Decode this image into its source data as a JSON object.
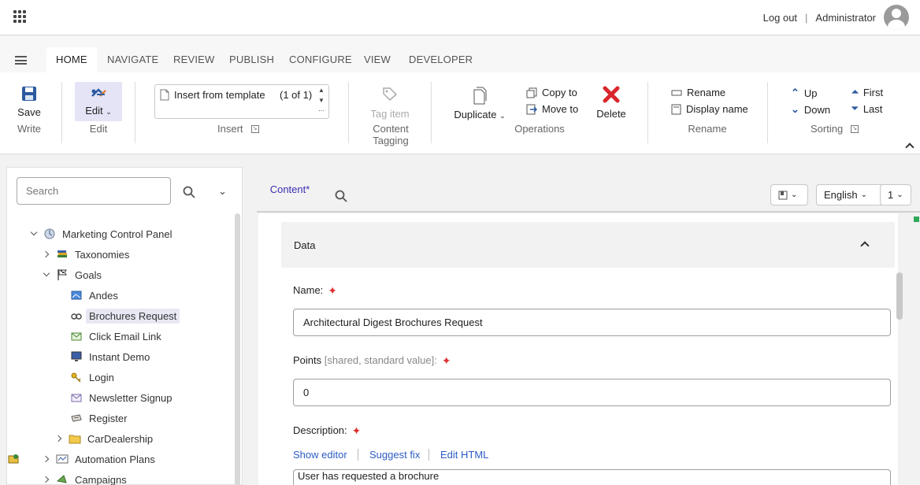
{
  "topbar": {
    "logout": "Log out",
    "separator": "|",
    "user": "Administrator"
  },
  "ribbon_tabs": [
    "HOME",
    "NAVIGATE",
    "REVIEW",
    "PUBLISH",
    "CONFIGURE",
    "VIEW",
    "DEVELOPER"
  ],
  "ribbon": {
    "write": {
      "save": "Save",
      "group": "Write"
    },
    "edit": {
      "edit": "Edit",
      "group": "Edit"
    },
    "insert": {
      "template": "Insert from template",
      "count": "(1 of 1)",
      "group": "Insert"
    },
    "tagging": {
      "tag_item": "Tag item",
      "group": "Content Tagging"
    },
    "operations": {
      "duplicate": "Duplicate",
      "copy_to": "Copy to",
      "move_to": "Move to",
      "delete": "Delete",
      "group": "Operations"
    },
    "rename": {
      "rename": "Rename",
      "display_name": "Display name",
      "group": "Rename"
    },
    "sorting": {
      "up": "Up",
      "down": "Down",
      "first": "First",
      "last": "Last",
      "group": "Sorting"
    }
  },
  "left": {
    "search_placeholder": "Search",
    "tree": [
      {
        "label": "Marketing Control Panel",
        "icon": "control-panel-icon"
      },
      {
        "label": "Taxonomies",
        "icon": "books-icon"
      },
      {
        "label": "Goals",
        "icon": "flag-icon"
      },
      {
        "label": "Andes",
        "icon": "brochure-icon"
      },
      {
        "label": "Brochures Request",
        "icon": "glasses-icon"
      },
      {
        "label": "Click Email Link",
        "icon": "email-link-icon"
      },
      {
        "label": "Instant Demo",
        "icon": "monitor-icon"
      },
      {
        "label": "Login",
        "icon": "key-icon"
      },
      {
        "label": "Newsletter Signup",
        "icon": "envelope-icon"
      },
      {
        "label": "Register",
        "icon": "register-icon"
      },
      {
        "label": "CarDealership",
        "icon": "folder-icon"
      },
      {
        "label": "Automation Plans",
        "icon": "automation-icon"
      },
      {
        "label": "Campaigns",
        "icon": "campaigns-icon"
      }
    ]
  },
  "content": {
    "tab": "Content*",
    "language": "English",
    "version": "1",
    "section": "Data",
    "name_label": "Name:",
    "name_value": "Architectural Digest Brochures Request",
    "points_label": "Points",
    "points_hint": "[shared, standard value]:",
    "points_value": "0",
    "description_label": "Description:",
    "show_editor": "Show editor",
    "suggest_fix": "Suggest fix",
    "edit_html": "Edit HTML",
    "description_value": "User has requested a brochure"
  },
  "colors": {
    "accent": "#3a2eb2",
    "link": "#2c5cc5",
    "sparkle": "#e03030",
    "delete": "#d9262b"
  }
}
